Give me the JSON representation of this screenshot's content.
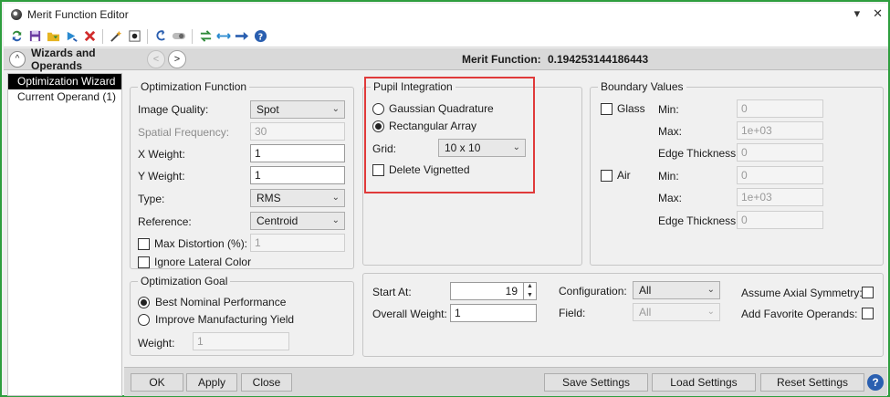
{
  "window": {
    "title": "Merit Function Editor",
    "controls": {
      "dropdown": "▾",
      "close": "✕"
    }
  },
  "toolbar": {
    "icons": [
      "refresh-icon",
      "save-icon",
      "load-icon",
      "insert-icon",
      "delete-icon",
      "wizard-icon",
      "stop-icon",
      "undo-icon",
      "toggle-icon",
      "sync-icon",
      "expand-icon",
      "arrow-icon",
      "help-icon"
    ]
  },
  "header": {
    "section_title": "Wizards and Operands",
    "merit_label": "Merit Function:",
    "merit_value": "0.194253144186443",
    "collapse_glyph": "^",
    "prev_glyph": "<",
    "next_glyph": ">"
  },
  "sidebar": {
    "items": [
      {
        "label": "Optimization Wizard",
        "selected": true
      },
      {
        "label": "Current Operand (1)",
        "selected": false
      }
    ]
  },
  "optimization_function": {
    "title": "Optimization Function",
    "image_quality": {
      "label": "Image Quality:",
      "value": "Spot"
    },
    "spatial_frequency": {
      "label": "Spatial Frequency:",
      "value": "30"
    },
    "x_weight": {
      "label": "X Weight:",
      "value": "1"
    },
    "y_weight": {
      "label": "Y Weight:",
      "value": "1"
    },
    "type": {
      "label": "Type:",
      "value": "RMS"
    },
    "reference": {
      "label": "Reference:",
      "value": "Centroid"
    },
    "max_distortion": {
      "label": "Max Distortion (%):",
      "value": "1",
      "checked": false
    },
    "ignore_lateral_color": {
      "label": "Ignore Lateral Color",
      "checked": false
    }
  },
  "optimization_goal": {
    "title": "Optimization Goal",
    "options": [
      {
        "label": "Best Nominal Performance",
        "selected": true
      },
      {
        "label": "Improve Manufacturing Yield",
        "selected": false
      }
    ],
    "weight": {
      "label": "Weight:",
      "value": "1"
    }
  },
  "pupil_integration": {
    "title": "Pupil Integration",
    "options": [
      {
        "label": "Gaussian Quadrature",
        "selected": false
      },
      {
        "label": "Rectangular Array",
        "selected": true
      }
    ],
    "grid": {
      "label": "Grid:",
      "value": "10 x 10"
    },
    "delete_vignetted": {
      "label": "Delete Vignetted",
      "checked": false
    },
    "highlight_color": "#e03a3a"
  },
  "boundary_values": {
    "title": "Boundary Values",
    "glass": {
      "label": "Glass",
      "checked": false,
      "min": {
        "label": "Min:",
        "value": "0"
      },
      "max": {
        "label": "Max:",
        "value": "1e+03"
      },
      "edge": {
        "label": "Edge Thickness:",
        "value": "0"
      }
    },
    "air": {
      "label": "Air",
      "checked": false,
      "min": {
        "label": "Min:",
        "value": "0"
      },
      "max": {
        "label": "Max:",
        "value": "1e+03"
      },
      "edge": {
        "label": "Edge Thickness:",
        "value": "0"
      }
    }
  },
  "operand_settings": {
    "start_at": {
      "label": "Start At:",
      "value": "19"
    },
    "overall_weight": {
      "label": "Overall Weight:",
      "value": "1"
    },
    "configuration": {
      "label": "Configuration:",
      "value": "All"
    },
    "field": {
      "label": "Field:",
      "value": "All"
    },
    "assume_axial_symmetry": {
      "label": "Assume Axial Symmetry:",
      "checked": false
    },
    "add_favorite_operands": {
      "label": "Add Favorite Operands:",
      "checked": false
    }
  },
  "buttons": {
    "ok": "OK",
    "apply": "Apply",
    "close": "Close",
    "save_settings": "Save Settings",
    "load_settings": "Load Settings",
    "reset_settings": "Reset Settings",
    "help": "?"
  },
  "colors": {
    "window_border": "#2e9e3e",
    "accent_blue": "#2a5fb0"
  }
}
